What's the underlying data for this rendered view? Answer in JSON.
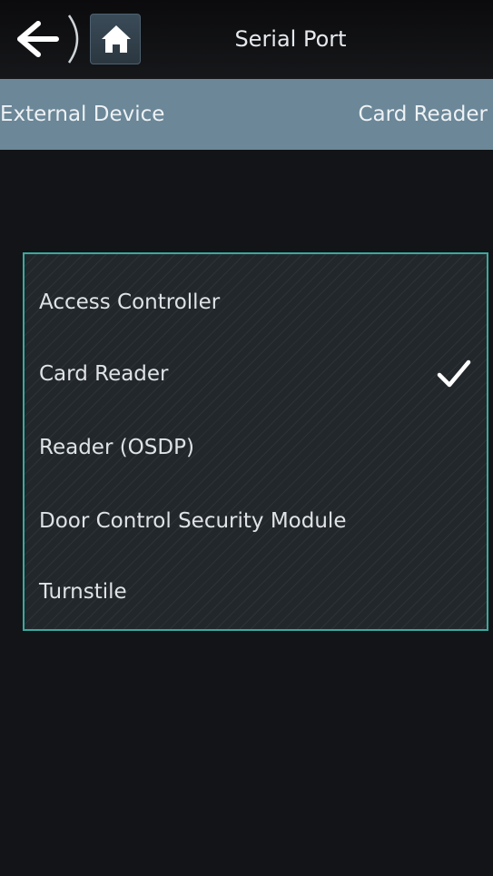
{
  "header": {
    "title": "Serial Port",
    "back_icon": "back-arrow-icon",
    "home_icon": "home-icon"
  },
  "setting": {
    "label": "External Device",
    "value": "Card Reader"
  },
  "options": [
    {
      "label": "Access Controller",
      "selected": false
    },
    {
      "label": "Card Reader",
      "selected": true
    },
    {
      "label": "Reader (OSDP)",
      "selected": false
    },
    {
      "label": "Door Control Security Module",
      "selected": false
    },
    {
      "label": "Turnstile",
      "selected": false
    }
  ],
  "colors": {
    "background": "#121417",
    "subheader": "#6b8798",
    "panel_border": "#3aa99e",
    "text": "#e6e9ec"
  }
}
